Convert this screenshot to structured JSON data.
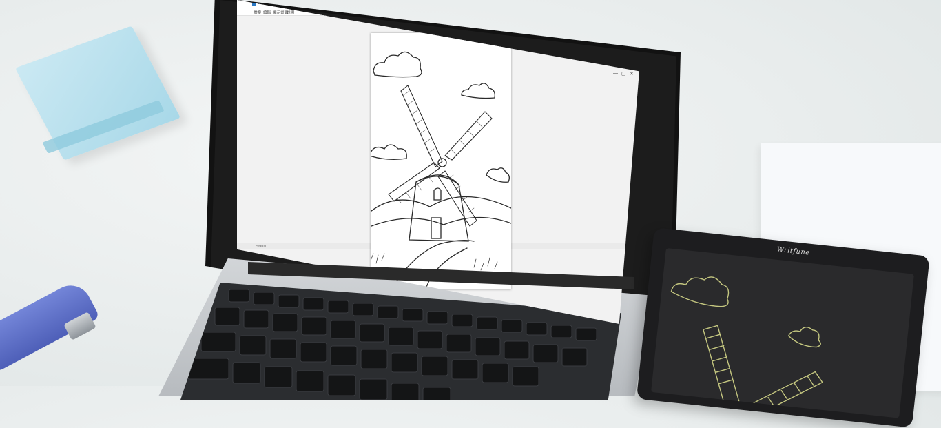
{
  "app": {
    "title": "Writfun HUB Tool",
    "menu": [
      "檔案",
      "編輯",
      "顯示畫面",
      "說明"
    ],
    "window_controls": [
      "—",
      "▢",
      "✕"
    ],
    "status": "Status"
  },
  "tablet": {
    "brand": "Writfune"
  },
  "colors": {
    "sticky_note": "#a8d8e8",
    "stapler": "#5566c4",
    "laptop_bezel": "#141414",
    "tablet_ink": "#d6d98a"
  }
}
